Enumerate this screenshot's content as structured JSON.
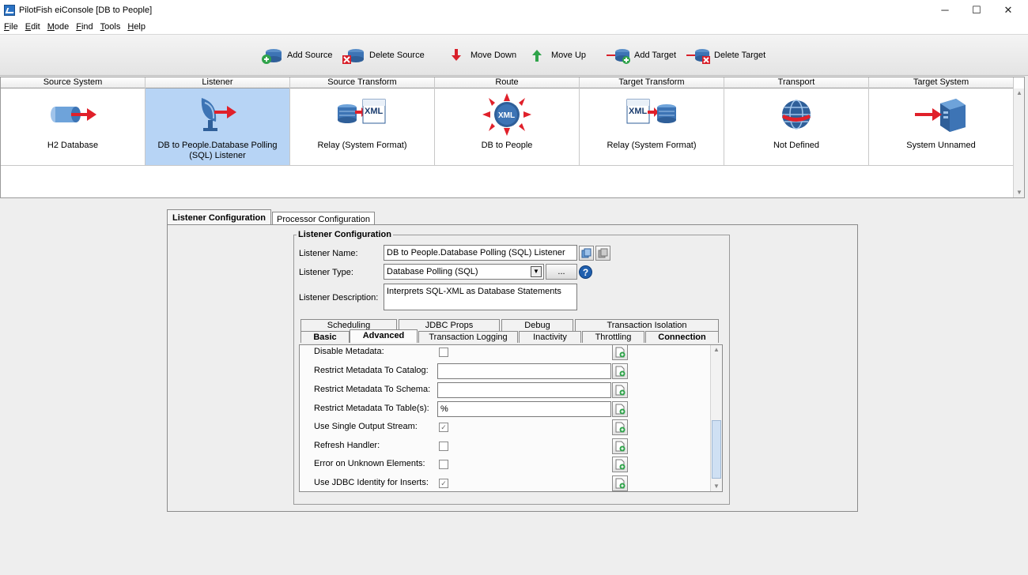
{
  "window": {
    "title": "PilotFish eiConsole [DB to People]",
    "controls": {
      "minimize": "─",
      "maximize": "☐",
      "close": "✕"
    }
  },
  "menu": [
    {
      "label": "File",
      "mnemonic": "F"
    },
    {
      "label": "Edit",
      "mnemonic": "E"
    },
    {
      "label": "Mode",
      "mnemonic": "M"
    },
    {
      "label": "Find",
      "mnemonic": "F"
    },
    {
      "label": "Tools",
      "mnemonic": "T"
    },
    {
      "label": "Help",
      "mnemonic": "H"
    }
  ],
  "toolbar": {
    "add_source": "Add Source",
    "delete_source": "Delete Source",
    "move_down": "Move Down",
    "move_up": "Move Up",
    "add_target": "Add Target",
    "delete_target": "Delete Target"
  },
  "pipeline": [
    {
      "header": "Source System",
      "label": "H2 Database",
      "icon": "database-arrow-icon"
    },
    {
      "header": "Listener",
      "label": "DB to People.Database Polling (SQL) Listener",
      "icon": "satellite-dish-icon",
      "selected": true
    },
    {
      "header": "Source Transform",
      "label": "Relay (System Format)",
      "icon": "xml-transform-icon"
    },
    {
      "header": "Route",
      "label": "DB to People",
      "icon": "xml-route-icon"
    },
    {
      "header": "Target Transform",
      "label": "Relay (System Format)",
      "icon": "xml-transform-icon"
    },
    {
      "header": "Transport",
      "label": "Not Defined",
      "icon": "globe-icon"
    },
    {
      "header": "Target System",
      "label": "System Unnamed",
      "icon": "server-arrow-icon"
    }
  ],
  "tabs": {
    "listener_configuration": "Listener Configuration",
    "processor_configuration": "Processor Configuration"
  },
  "listener": {
    "group_title": "Listener Configuration",
    "name_label": "Listener Name:",
    "name_value": "DB to People.Database Polling (SQL) Listener",
    "type_label": "Listener Type:",
    "type_value": "Database Polling (SQL)",
    "ellipsis": "...",
    "description_label": "Listener Description:",
    "description_value": "Interprets SQL-XML as Database Statements"
  },
  "inner_tabs_row1": [
    "Scheduling",
    "JDBC Props",
    "Debug",
    "Transaction Isolation"
  ],
  "inner_tabs_row2": [
    "Basic",
    "Advanced",
    "Transaction Logging",
    "Inactivity",
    "Throttling",
    "Connection"
  ],
  "properties": [
    {
      "label": "Disable Metadata:",
      "type": "checkbox",
      "checked": false
    },
    {
      "label": "Restrict Metadata To Catalog:",
      "type": "text",
      "value": ""
    },
    {
      "label": "Restrict Metadata To Schema:",
      "type": "text",
      "value": ""
    },
    {
      "label": "Restrict Metadata To Table(s):",
      "type": "text",
      "value": "%"
    },
    {
      "label": "Use Single Output Stream:",
      "type": "checkbox",
      "checked": true
    },
    {
      "label": "Refresh Handler:",
      "type": "checkbox",
      "checked": false
    },
    {
      "label": "Error on Unknown Elements:",
      "type": "checkbox",
      "checked": false
    },
    {
      "label": "Use JDBC Identity for Inserts:",
      "type": "checkbox",
      "checked": true
    }
  ],
  "colors": {
    "selection": "#b7d4f5",
    "accent_red": "#e0202a",
    "accent_blue": "#2a6fb8"
  }
}
